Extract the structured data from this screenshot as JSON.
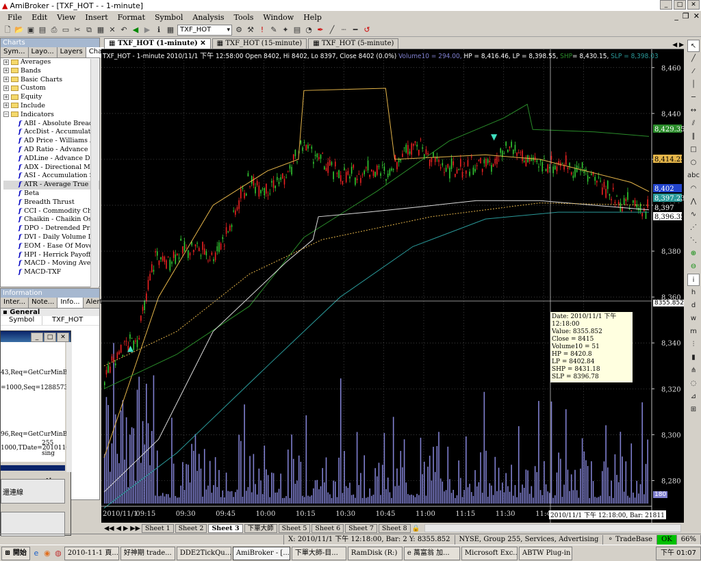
{
  "window": {
    "title": "AmiBroker - [TXF_HOT - - 1-minute]"
  },
  "menu": [
    "File",
    "Edit",
    "View",
    "Insert",
    "Format",
    "Symbol",
    "Analysis",
    "Tools",
    "Window",
    "Help"
  ],
  "toolbar": {
    "symbol": "TXF_HOT"
  },
  "charts_panel": {
    "title": "Charts",
    "tabs": [
      "Sym...",
      "Layo...",
      "Layers",
      "Charts"
    ],
    "folders": [
      "Averages",
      "Bands",
      "Basic Charts",
      "Custom",
      "Equity",
      "Include",
      "Indicators"
    ],
    "indicators": [
      "ABI - Absolute Breadt",
      "AccDist - Accumulatio",
      "AD Price - Williams A",
      "AD Ratio - Advance I",
      "ADLine - Advance De",
      "ADX - Directional Mo",
      "ASI - Accumulation S",
      "ATR - Average True",
      "Beta",
      "Breadth Thrust",
      "CCI - Commodity Ch",
      "Chaikin - Chaikin Os",
      "DPO - Detrended Pric",
      "DVI - Daily Volume I",
      "EOM - Ease Of Move",
      "HPI - Herrick Payoff",
      "MACD - Moving Ave",
      "MACD-TXF"
    ]
  },
  "info_panel": {
    "title": "Information",
    "tabs": [
      "Inter...",
      "Note...",
      "Info...",
      "Alert..."
    ],
    "section": "General",
    "symbol_label": "Symbol",
    "symbol_value": "TXF_HOT"
  },
  "float_window": {
    "lines": [
      "43,Req=GetCurMinB",
      "=1000,Seq=1288573",
      "96,Req=GetCurMinB",
      "255",
      "1000,TDate=201011C",
      "sing"
    ],
    "section": "ction",
    "status": "還連線"
  },
  "chart_tabs": [
    "TXF_HOT (1-minute)",
    "TXF_HOT (15-minute)",
    "TXF_HOT (5-minute)"
  ],
  "chart_header": {
    "main": "TXF_HOT - 1-minute 2010/11/1 下午 12:58:00 Open 8402, Hi 8402, Lo 8397, Close 8402 (0.0%)",
    "vol": "Volume10 = 294.00,",
    "hp": "HP = 8,416.46,",
    "lp": "LP = 8,398.55,",
    "shp_label": "SHP",
    "shp_val": "= 8,430.15,",
    "slp": "SLP = 8,398.03"
  },
  "colors": {
    "bull": "#33cc33",
    "bear": "#ee2222",
    "volume": "#8080d0",
    "hp": "#e6b64a",
    "lp": "#dddddd",
    "shp": "#2a8c2a",
    "slp": "#2a9a9a",
    "accent": "#0a246a"
  },
  "chart_data": {
    "type": "line",
    "title": "TXF_HOT - 1-minute",
    "ylim": [
      8270,
      8465
    ],
    "y_ticks": [
      8280,
      8300,
      8320,
      8340,
      8360,
      8380,
      8400,
      8420,
      8440,
      8460
    ],
    "x_ticks": [
      "2010/11/1",
      "09:15",
      "09:30",
      "09:45",
      "10:00",
      "10:15",
      "10:30",
      "10:45",
      "11:00",
      "11:15",
      "11:30",
      "11:45",
      "12:00"
    ],
    "series": [
      {
        "name": "HP",
        "points": [
          [
            0,
            8290
          ],
          [
            30,
            8360
          ],
          [
            60,
            8400
          ],
          [
            90,
            8415
          ],
          [
            107,
            8420
          ],
          [
            110,
            8450
          ],
          [
            155,
            8451
          ],
          [
            160,
            8420
          ],
          [
            210,
            8422
          ],
          [
            240,
            8420
          ],
          [
            290,
            8410
          ],
          [
            300,
            8406
          ]
        ]
      },
      {
        "name": "SHP",
        "points": [
          [
            0,
            8320
          ],
          [
            40,
            8335
          ],
          [
            80,
            8356
          ],
          [
            110,
            8386
          ],
          [
            150,
            8406
          ],
          [
            190,
            8428
          ],
          [
            220,
            8438
          ],
          [
            233,
            8444
          ],
          [
            236,
            8433
          ],
          [
            270,
            8432
          ],
          [
            300,
            8430
          ]
        ]
      },
      {
        "name": "LP",
        "points": [
          [
            0,
            8275
          ],
          [
            30,
            8298
          ],
          [
            60,
            8345
          ],
          [
            100,
            8375
          ],
          [
            115,
            8385
          ],
          [
            118,
            8395
          ],
          [
            145,
            8397
          ],
          [
            170,
            8399
          ],
          [
            205,
            8402
          ],
          [
            240,
            8402
          ],
          [
            300,
            8398
          ]
        ]
      },
      {
        "name": "SLP",
        "points": [
          [
            0,
            8268
          ],
          [
            40,
            8292
          ],
          [
            90,
            8330
          ],
          [
            130,
            8360
          ],
          [
            170,
            8382
          ],
          [
            210,
            8394
          ],
          [
            250,
            8397
          ],
          [
            300,
            8397
          ]
        ]
      },
      {
        "name": "Volume10",
        "points": [
          [
            0,
            8330
          ],
          [
            40,
            8345
          ],
          [
            80,
            8370
          ],
          [
            120,
            8385
          ],
          [
            180,
            8395
          ],
          [
            240,
            8401
          ],
          [
            300,
            8400
          ]
        ]
      }
    ],
    "price_path": [
      [
        0,
        8325
      ],
      [
        10,
        8338
      ],
      [
        18,
        8342
      ],
      [
        22,
        8355
      ],
      [
        25,
        8368
      ],
      [
        28,
        8378
      ],
      [
        34,
        8375
      ],
      [
        40,
        8380
      ],
      [
        50,
        8382
      ],
      [
        60,
        8378
      ],
      [
        70,
        8392
      ],
      [
        75,
        8405
      ],
      [
        80,
        8410
      ],
      [
        90,
        8408
      ],
      [
        100,
        8412
      ],
      [
        105,
        8420
      ],
      [
        110,
        8427
      ],
      [
        115,
        8422
      ],
      [
        125,
        8415
      ],
      [
        135,
        8412
      ],
      [
        145,
        8416
      ],
      [
        155,
        8414
      ],
      [
        170,
        8428
      ],
      [
        180,
        8420
      ],
      [
        190,
        8415
      ],
      [
        200,
        8417
      ],
      [
        215,
        8418
      ],
      [
        224,
        8425
      ],
      [
        235,
        8418
      ],
      [
        250,
        8418
      ],
      [
        260,
        8416
      ],
      [
        270,
        8412
      ],
      [
        280,
        8404
      ],
      [
        290,
        8400
      ],
      [
        300,
        8398
      ]
    ],
    "price_labels": [
      {
        "text": "8,429.35",
        "color": "#2a8c2a"
      },
      {
        "text": "8,414.25",
        "color": "#e6b64a"
      },
      {
        "text": "8,402",
        "color": "#2244cc"
      },
      {
        "text": "8,397.23",
        "color": "#2a9a9a"
      },
      {
        "text": "8,397",
        "color": "#000000"
      },
      {
        "text": "8,396.35",
        "color": "#ffffff"
      }
    ],
    "crosshair_value": "8355.852",
    "volume_label": "180"
  },
  "tooltip": {
    "lines": [
      "Date: 2010/11/1 下午 12:18:00",
      "Value: 8355.852",
      "Close = 8415",
      "Volume10 = 51",
      "HP = 8420.8",
      "LP = 8402.84",
      "SHP = 8431.18",
      "SLP = 8396.78"
    ]
  },
  "xaxis_info": "2010/11/1 下午 12:18:00, Bar: 21811",
  "sheets": [
    "Sheet 1",
    "Sheet 2",
    "Sheet 3",
    "下單大師",
    "Sheet 5",
    "Sheet 6",
    "Sheet 7",
    "Sheet 8"
  ],
  "status": {
    "coords": "X: 2010/11/1 下午 12:18:00, Bar: 2 Y: 8355.852",
    "market": "NYSE, Group 255, Services, Advertising",
    "db": "TradeBase",
    "ok": "OK",
    "pct": "66%"
  },
  "taskbar": {
    "start": "開始",
    "tasks": [
      "2010-11-1 頁...",
      "好神期 trade...",
      "DDE2TickQu...",
      "AmiBroker - [...",
      "下單大師-目...",
      "RamDisk (R:)",
      "e 萬富翁 加...",
      "Microsoft Exc...",
      "ABTW Plug-in"
    ],
    "clock": "下午 01:07"
  }
}
